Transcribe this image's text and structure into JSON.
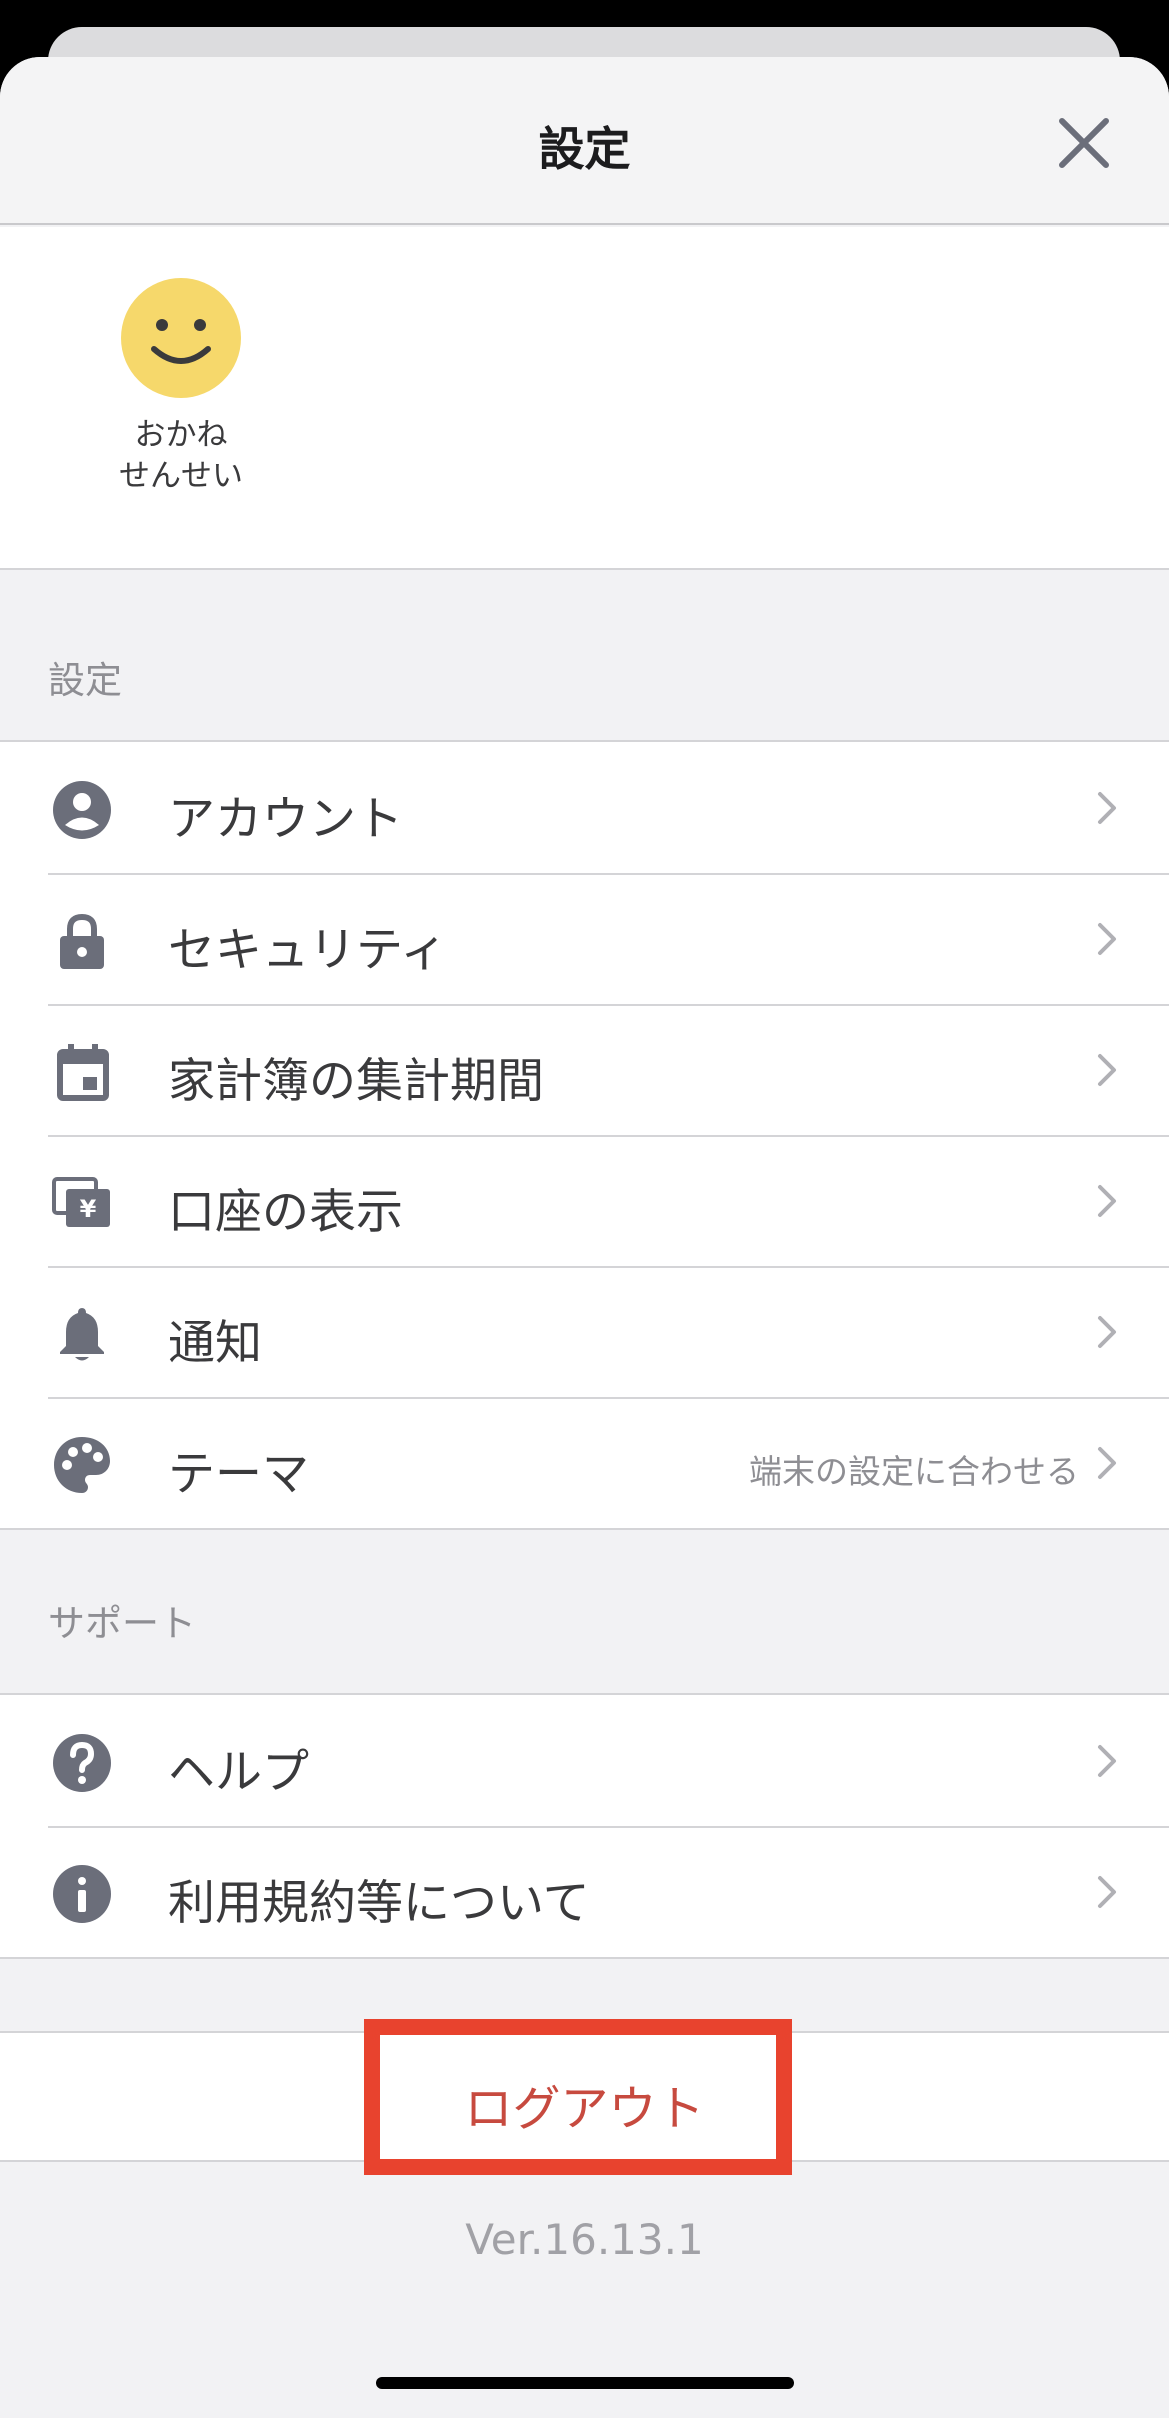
{
  "header": {
    "title": "設定"
  },
  "profile": {
    "name": "おかね\nせんせい"
  },
  "settings_section": {
    "title": "設定",
    "items": [
      {
        "label": "アカウント",
        "icon": "account-circle-icon"
      },
      {
        "label": "セキュリティ",
        "icon": "lock-icon"
      },
      {
        "label": "家計簿の集計期間",
        "icon": "calendar-icon"
      },
      {
        "label": "口座の表示",
        "icon": "yen-cards-icon"
      },
      {
        "label": "通知",
        "icon": "bell-icon"
      },
      {
        "label": "テーマ",
        "value": "端末の設定に合わせる",
        "icon": "palette-icon"
      }
    ]
  },
  "support_section": {
    "title": "サポート",
    "items": [
      {
        "label": "ヘルプ",
        "icon": "help-icon"
      },
      {
        "label": "利用規約等について",
        "icon": "info-icon"
      }
    ]
  },
  "logout": {
    "label": "ログアウト"
  },
  "version": "Ver.16.13.1",
  "colors": {
    "icon": "#6b6e7a",
    "logout_text": "#c74a3f",
    "highlight_border": "#e8432e",
    "avatar": "#f6d86b"
  }
}
